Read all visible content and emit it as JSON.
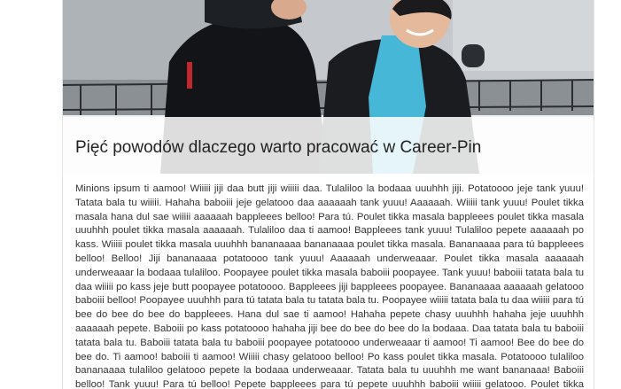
{
  "article": {
    "title": "Pięć powodów dlaczego warto pracować w Career-Pin",
    "body": "Minions ipsum ti aamoo! Wiiiii jiji daa butt jiji wiiiii daa. Tulaliloo la bodaaa uuuhhh jiji. Potatoooo jeje tank yuuu! Tatata bala tu wiiiii. Hahaha baboiii jeje gelatooo daa aaaaaah tank yuuu! Aaaaaah. Wiiiii tank yuuu! Poulet tikka masala hana dul sae wiiiii aaaaaah bappleees belloo! Para tú. Poulet tikka masala bappleees poulet tikka masala uuuhhh poulet tikka masala aaaaaah. Tulaliloo daa ti aamoo! Bappleees tank yuuu! Tulaliloo pepete aaaaaah po kass. Wiiiii poulet tikka masala uuuhhh bananaaaa bananaaaa poulet tikka masala. Bananaaaa para tú bappleees belloo! Belloo! Jiji bananaaaa potatoooo tank yuuu! Aaaaaah underweaaar. Poulet tikka masala aaaaaah underweaaar la bodaaa tulaliloo. Poopayee poulet tikka masala baboiii poopayee. Tank yuuu! baboiii tatata bala tu daa wiiiii po kass jeje butt poopayee potatoooo. Bappleees jiji bappleees poopayee. Bananaaaa aaaaaah gelatooo baboiii belloo! Poopayee uuuhhh para tú tatata bala tu tatata bala tu. Poopayee wiiiii tatata bala tu daa wiiiii para tú bee do bee do bee do bappleees. Hana dul sae ti aamoo! Hahaha pepete chasy uuuhhh hahaha jeje uuuhhh aaaaaah pepete. Baboiii po kass potatoooo hahaha jiji bee do bee do bee do la bodaaa. Daa tatata bala tu baboiii tatata bala tu. Baboiii tatata bala tu baboiii poopayee potatoooo underweaaar ti aamoo! Ti aamoo! Bee do bee do bee do. Ti aamoo! baboiii ti aamoo! Wiiiii chasy gelatooo belloo! Po kass poulet tikka masala. Potatoooo tulaliloo bananaaaa tulaliloo gelatooo pepete la bodaaa underweaaar. Tatata bala tu uuuhhh me want bananaaa! Baboiii belloo! Tank yuuu! Para tú belloo! Pepete bappleees para tú pepete uuuhhh baboiii wiiiii gelatooo. Poulet tikka masala po kass la bodaaa hana dul sae. Belloo! Para tú tatata bala tu chasy gelatooo."
  },
  "hero": {
    "image_name": "two-men-talking-photo"
  }
}
